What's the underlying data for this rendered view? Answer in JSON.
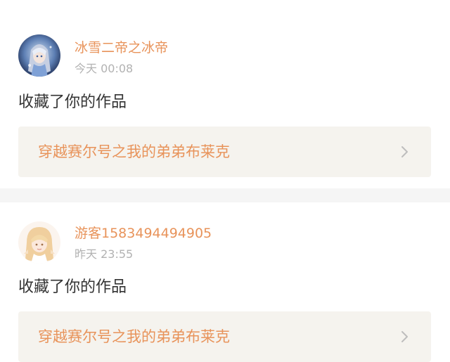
{
  "notifications": [
    {
      "username": "冰雪二帝之冰帝",
      "time": "今天 00:08",
      "action": "收藏了你的作品",
      "work_title": "穿越赛尔号之我的弟弟布莱克",
      "avatar_icon": "anime-avatar-blue-icon"
    },
    {
      "username": "游客1583494494905",
      "time": "昨天 23:55",
      "action": "收藏了你的作品",
      "work_title": "穿越赛尔号之我的弟弟布莱克",
      "avatar_icon": "anime-avatar-blonde-icon"
    }
  ],
  "colors": {
    "accent": "#e8935a",
    "muted": "#b2b2b2",
    "text": "#333333",
    "link_bg": "#f5f3ee",
    "page_bg": "#f5f5f5"
  }
}
